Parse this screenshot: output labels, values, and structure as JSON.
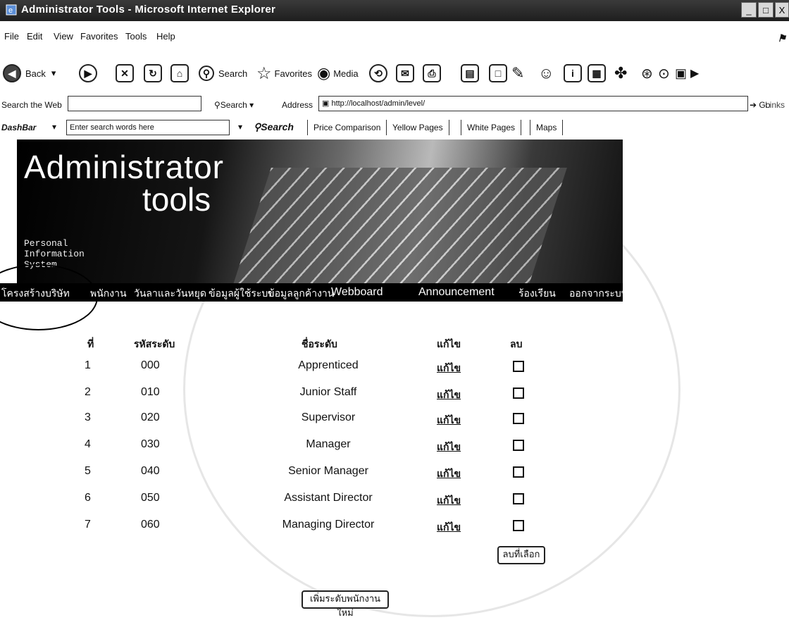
{
  "window": {
    "title": "Administrator Tools - Microsoft Internet Explorer",
    "buttons": [
      "_",
      "□",
      "X"
    ]
  },
  "menu": [
    "File",
    "Edit",
    "View",
    "Favorites",
    "Tools",
    "Help"
  ],
  "toolbar": {
    "back": "Back",
    "search": "Search",
    "favorites": "Favorites",
    "media": "Media"
  },
  "addressbar": {
    "search_label": "Search the Web",
    "search_btn": "Search",
    "address_label": "Address",
    "url": "http://localhost/admin/level/",
    "go": "Go",
    "links": "Links"
  },
  "dashbar": {
    "label": "DashBar",
    "input_placeholder": "Enter search words here",
    "search_btn": "Search",
    "links": [
      "Price Comparison",
      "Yellow Pages",
      "White Pages",
      "Maps"
    ]
  },
  "banner": {
    "line1": "Administrator",
    "line2": "tools",
    "sub": [
      "Personal",
      "Information",
      "System"
    ]
  },
  "nav": [
    "โครงสร้างบริษัท",
    "พนักงาน",
    "วันลาและวันหยุด",
    "ข้อมูลผู้ใช้ระบบ",
    "ข้อมูลลูกค้างาน",
    "Webboard",
    "Announcement",
    "ร้องเรียน",
    "ออกจากระบบ"
  ],
  "table": {
    "headers": [
      "ที่",
      "รหัสระดับ",
      "ชื่อระดับ",
      "แก้ไข",
      "ลบ"
    ],
    "rows": [
      {
        "no": "1",
        "code": "000",
        "name": "Apprenticed",
        "edit": "แก้ไข"
      },
      {
        "no": "2",
        "code": "010",
        "name": "Junior Staff",
        "edit": "แก้ไข"
      },
      {
        "no": "3",
        "code": "020",
        "name": "Supervisor",
        "edit": "แก้ไข"
      },
      {
        "no": "4",
        "code": "030",
        "name": "Manager",
        "edit": "แก้ไข"
      },
      {
        "no": "5",
        "code": "040",
        "name": "Senior Manager",
        "edit": "แก้ไข"
      },
      {
        "no": "6",
        "code": "050",
        "name": "Assistant Director",
        "edit": "แก้ไข"
      },
      {
        "no": "7",
        "code": "060",
        "name": "Managing Director",
        "edit": "แก้ไข"
      }
    ],
    "delete_selected": "ลบที่เลือก",
    "add_new": "เพิ่มระดับพนักงานใหม่"
  }
}
